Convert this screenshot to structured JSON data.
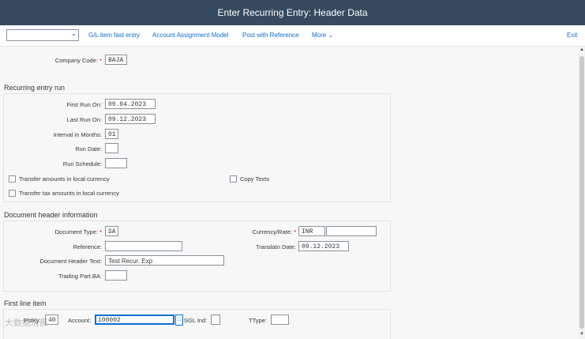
{
  "title": "Enter Recurring Entry: Header Data",
  "toolbar": {
    "select_value": "",
    "gl_fast_entry": "G/L item fast entry",
    "account_assignment_model": "Account Assignment Model",
    "post_with_reference": "Post with Reference",
    "more": "More",
    "exit": "Exit"
  },
  "company": {
    "label": "Company Code:",
    "value": "BAJA"
  },
  "recurring": {
    "title": "Recurring entry run",
    "first_run_label": "First Run On:",
    "first_run_value": "09.04.2023",
    "last_run_label": "Last Run On:",
    "last_run_value": "09.12.2023",
    "interval_label": "Interval in Months:",
    "interval_value": "01",
    "run_date_label": "Run Date:",
    "run_date_value": "",
    "run_schedule_label": "Run Schedule:",
    "run_schedule_value": "",
    "transfer_local_label": "Transfer amounts in local currency",
    "transfer_tax_label": "Transfer tax amounts in local currency",
    "copy_texts_label": "Copy Texts"
  },
  "doc_header": {
    "title": "Document header information",
    "doc_type_label": "Document Type:",
    "doc_type_value": "SA",
    "reference_label": "Reference:",
    "reference_value": "",
    "header_text_label": "Document Header Text:",
    "header_text_value": "Test Recur. Exp",
    "trading_part_label": "Trading Part.BA:",
    "trading_part_value": "",
    "currency_label": "Currency/Rate:",
    "currency_value": "INR",
    "rate_value": "",
    "translation_date_label": "Translatn Date:",
    "translation_date_value": "09.12.2023"
  },
  "first_line": {
    "title": "First line item",
    "pstky_label": "PstKy:",
    "pstky_value": "40",
    "account_label": "Account:",
    "account_value": "100002",
    "sgl_label": "SGL Ind:",
    "sgl_value": "",
    "ttype_label": "TType:",
    "ttype_value": ""
  },
  "watermark": "大数据清晨",
  "colors": {
    "shell": "#354a5f",
    "link": "#0a6ed1",
    "required": "#bb0000"
  }
}
